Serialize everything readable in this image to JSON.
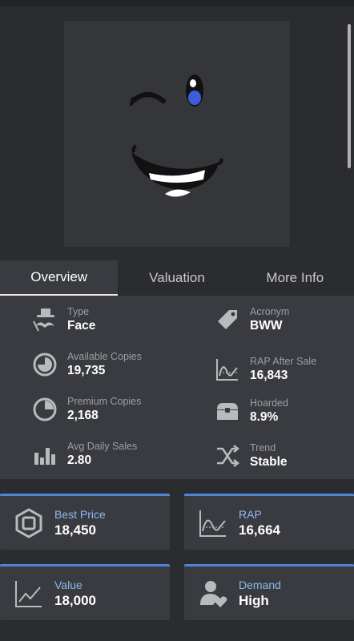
{
  "tabs": [
    {
      "label": "Overview",
      "active": true
    },
    {
      "label": "Valuation",
      "active": false
    },
    {
      "label": "More Info",
      "active": false
    }
  ],
  "stats": {
    "type": {
      "label": "Type",
      "value": "Face",
      "icon": "hat-mustache-icon"
    },
    "acronym": {
      "label": "Acronym",
      "value": "BWW",
      "icon": "tag-icon"
    },
    "available_copies": {
      "label": "Available Copies",
      "value": "19,735",
      "icon": "pie-chart-icon"
    },
    "rap_after_sale": {
      "label": "RAP After Sale",
      "value": "16,843",
      "icon": "line-chart-icon"
    },
    "premium_copies": {
      "label": "Premium Copies",
      "value": "2,168",
      "icon": "clock-pie-icon"
    },
    "hoarded": {
      "label": "Hoarded",
      "value": "8.9%",
      "icon": "treasure-chest-icon"
    },
    "avg_daily_sales": {
      "label": "Avg Daily Sales",
      "value": "2.80",
      "icon": "bar-chart-icon"
    },
    "trend": {
      "label": "Trend",
      "value": "Stable",
      "icon": "shuffle-icon"
    }
  },
  "cards": {
    "best_price": {
      "label": "Best Price",
      "value": "18,450",
      "icon": "robux-icon"
    },
    "rap": {
      "label": "RAP",
      "value": "16,664",
      "icon": "line-chart-icon"
    },
    "value": {
      "label": "Value",
      "value": "18,000",
      "icon": "trend-up-icon"
    },
    "demand": {
      "label": "Demand",
      "value": "High",
      "icon": "user-heart-icon"
    }
  },
  "colors": {
    "accent": "#4d86d8",
    "panel": "#393b40",
    "background": "#2b2c2f"
  }
}
